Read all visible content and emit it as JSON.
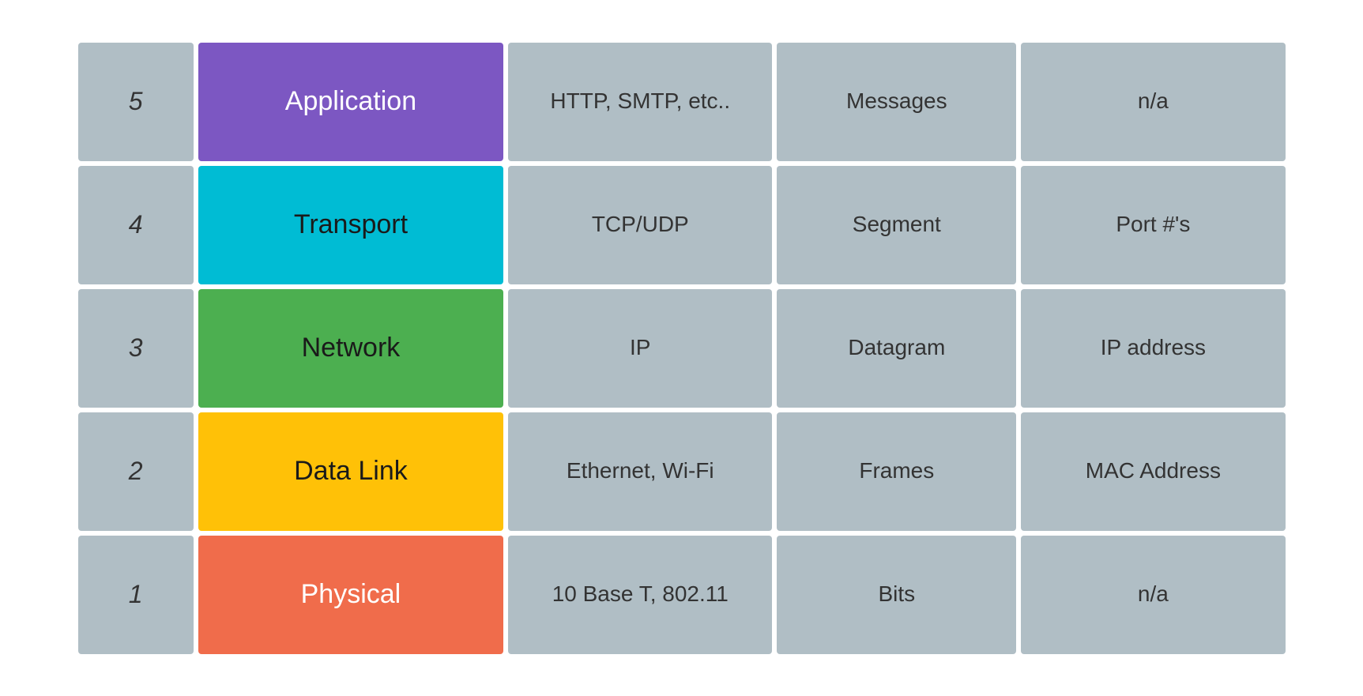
{
  "rows": [
    {
      "number": "5",
      "layer": "Application",
      "layerClass": "application",
      "protocol": "HTTP, SMTP, etc..",
      "pdu": "Messages",
      "addressing": "n/a"
    },
    {
      "number": "4",
      "layer": "Transport",
      "layerClass": "transport",
      "protocol": "TCP/UDP",
      "pdu": "Segment",
      "addressing": "Port #'s"
    },
    {
      "number": "3",
      "layer": "Network",
      "layerClass": "network",
      "protocol": "IP",
      "pdu": "Datagram",
      "addressing": "IP address"
    },
    {
      "number": "2",
      "layer": "Data Link",
      "layerClass": "datalink",
      "protocol": "Ethernet, Wi-Fi",
      "pdu": "Frames",
      "addressing": "MAC Address"
    },
    {
      "number": "1",
      "layer": "Physical",
      "layerClass": "physical",
      "protocol": "10 Base T, 802.11",
      "pdu": "Bits",
      "addressing": "n/a"
    }
  ]
}
